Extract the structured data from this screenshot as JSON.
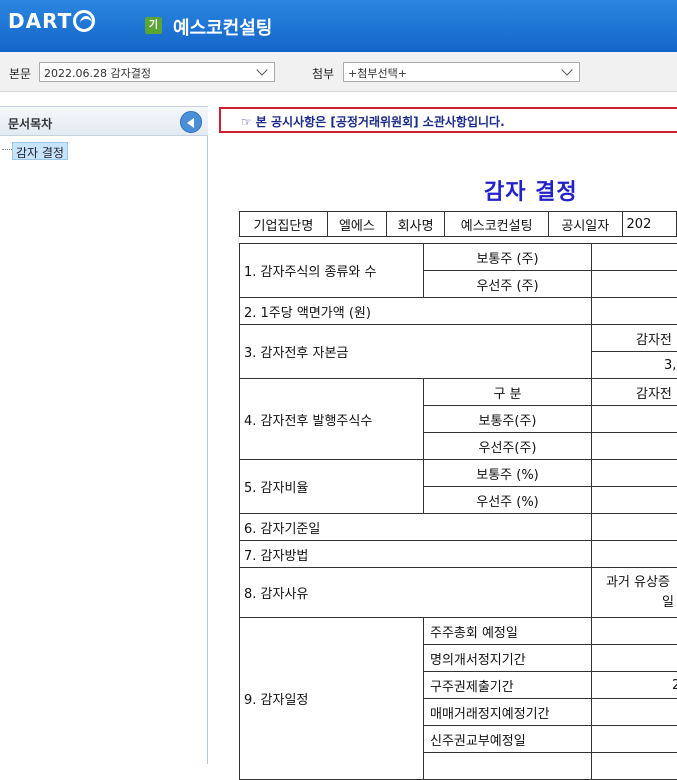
{
  "header": {
    "logo_text": "DART",
    "corp_badge": "기",
    "corp_name": "예스코컨설팅"
  },
  "toolbar": {
    "body_label": "본문",
    "body_select": "2022.06.28  감자결정",
    "attach_label": "첨부",
    "attach_select": "+첨부선택+"
  },
  "sidebar": {
    "title": "문서목차",
    "items": [
      {
        "label": "감자 결정"
      }
    ]
  },
  "document": {
    "notice": "본 공시사항은 [공정거래위원회] 소관사항입니다.",
    "notice_icon": "☞",
    "title": "감자 결정",
    "meta": {
      "group_label": "기업집단명",
      "group_value": "엘에스",
      "company_label": "회사명",
      "company_value": "예스코컨설팅",
      "date_label": "공시일자",
      "date_value_partial": "202"
    },
    "rows": {
      "r1_label": "1. 감자주식의 종류와 수",
      "r1_common": "보통주 (주)",
      "r1_pref": "우선주 (주)",
      "r2_label": "2. 1주당 액면가액 (원)",
      "r3_label": "3. 감자전후 자본금",
      "r3_before_partial": "감자전",
      "r3_value_partial": "3,",
      "r4_label": "4. 감자전후 발행주식수",
      "r4_col": "구   분",
      "r4_before_partial": "감자전",
      "r4_common": "보통주(주)",
      "r4_pref": "우선주(주)",
      "r5_label": "5. 감자비율",
      "r5_common": "보통주 (%)",
      "r5_pref": "우선주 (%)",
      "r6_label": "6. 감자기준일",
      "r7_label": "7. 감자방법",
      "r8_label": "8. 감자사유",
      "r8_value_line1": "과거 유상증",
      "r8_value_line2": "일",
      "r9_label": "9. 감자일정",
      "r9_a": "주주총회 예정일",
      "r9_b": "명의개서정지기간",
      "r9_c": "구주권제출기간",
      "r9_c_value_partial": "2",
      "r9_d": "매매거래정지예정기간",
      "r9_e": "신주권교부예정일"
    }
  }
}
